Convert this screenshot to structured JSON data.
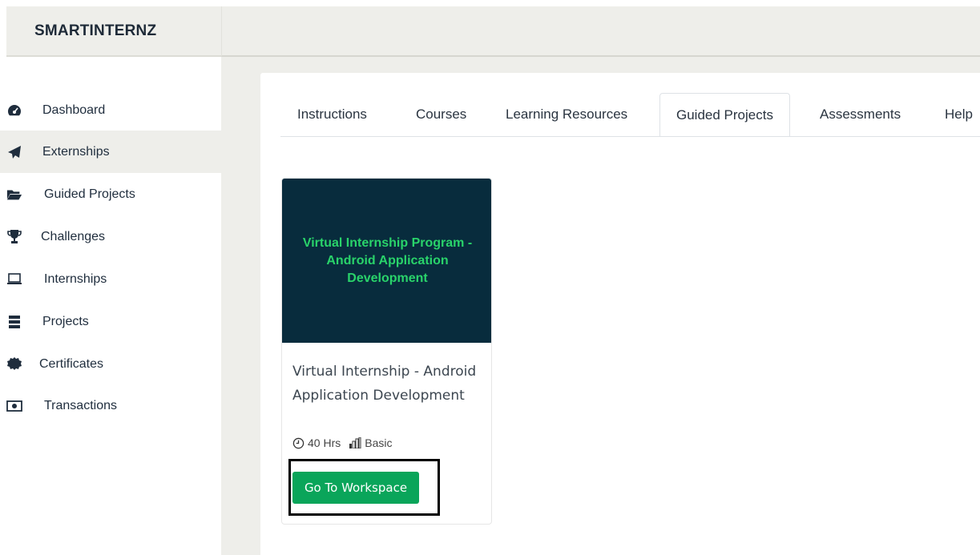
{
  "brand": {
    "name": "SMARTINTERNZ"
  },
  "sidebar": {
    "items": [
      {
        "label": "Dashboard",
        "icon": "dashboard-icon"
      },
      {
        "label": "Externships",
        "icon": "paper-plane-icon",
        "active": true
      },
      {
        "label": "Guided Projects",
        "icon": "folder-open-icon"
      },
      {
        "label": "Challenges",
        "icon": "trophy-icon"
      },
      {
        "label": "Internships",
        "icon": "laptop-icon"
      },
      {
        "label": "Projects",
        "icon": "server-icon"
      },
      {
        "label": "Certificates",
        "icon": "certificate-icon"
      },
      {
        "label": "Transactions",
        "icon": "money-icon"
      }
    ]
  },
  "tabs": [
    {
      "label": "Instructions"
    },
    {
      "label": "Courses"
    },
    {
      "label": "Learning Resources"
    },
    {
      "label": "Guided Projects",
      "active": true
    },
    {
      "label": "Assessments"
    },
    {
      "label": "Help"
    }
  ],
  "card": {
    "banner_text": "Virtual Internship Program - Android Application Development",
    "title": "Virtual Internship - Android Application Development",
    "duration": "40 Hrs",
    "level": "Basic",
    "button_label": "Go To Workspace"
  },
  "colors": {
    "accent_green": "#0aa55a",
    "banner_bg": "#082c3d",
    "banner_text": "#29d36a",
    "chrome_bg": "#eeeeea"
  }
}
